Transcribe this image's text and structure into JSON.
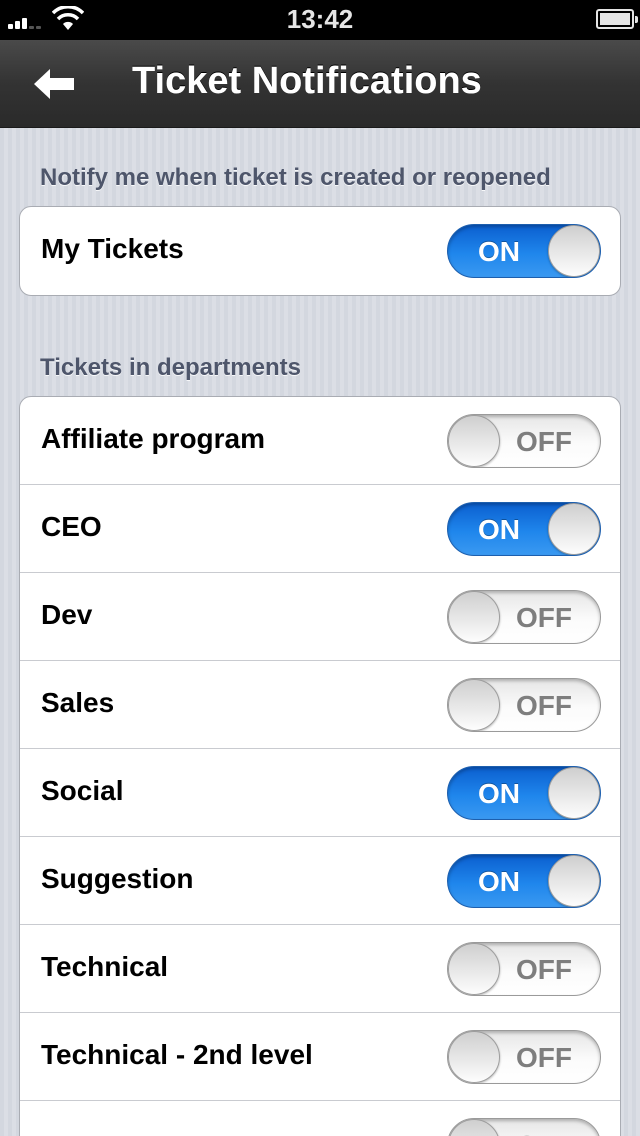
{
  "status_bar": {
    "time": "13:42"
  },
  "nav": {
    "title": "Ticket Notifications"
  },
  "section1": {
    "header": "Notify me when ticket is created or reopened",
    "rows": [
      {
        "label": "My Tickets",
        "state": "ON"
      }
    ]
  },
  "section2": {
    "header": "Tickets in departments",
    "rows": [
      {
        "label": "Affiliate program",
        "state": "OFF"
      },
      {
        "label": "CEO",
        "state": "ON"
      },
      {
        "label": "Dev",
        "state": "OFF"
      },
      {
        "label": "Sales",
        "state": "OFF"
      },
      {
        "label": "Social",
        "state": "ON"
      },
      {
        "label": "Suggestion",
        "state": "ON"
      },
      {
        "label": "Technical",
        "state": "OFF"
      },
      {
        "label": "Technical - 2nd level",
        "state": "OFF"
      },
      {
        "label": "",
        "state": "OFF"
      }
    ]
  }
}
